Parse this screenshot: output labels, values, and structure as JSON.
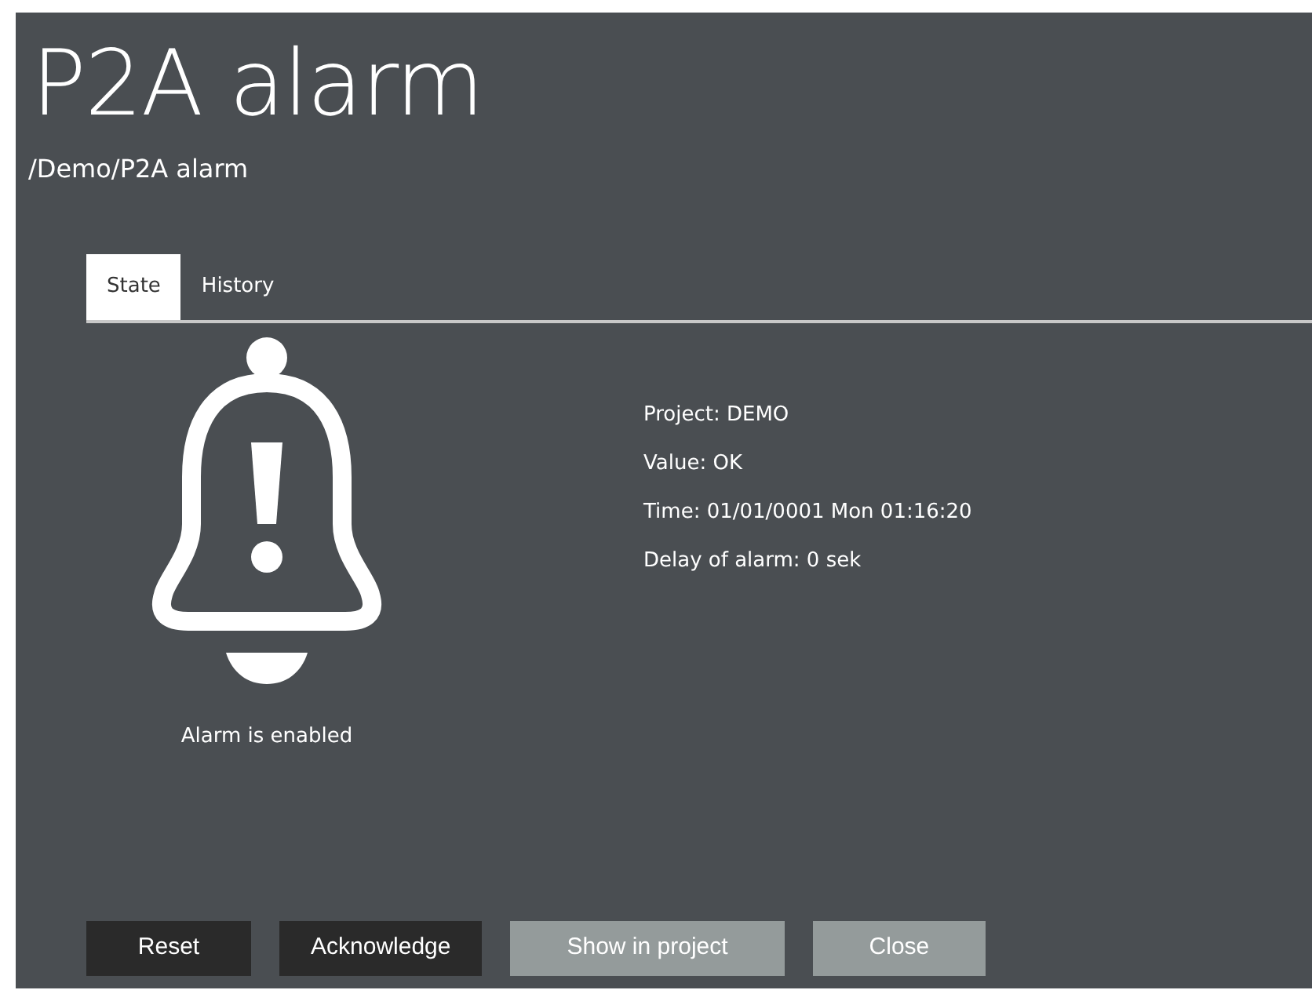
{
  "title": "P2A alarm",
  "path": "/Demo/P2A alarm",
  "tabs": [
    {
      "label": "State",
      "selected": true
    },
    {
      "label": "History",
      "selected": false
    }
  ],
  "status": {
    "text": "Alarm is enabled",
    "enabled": true
  },
  "details": [
    "Project: DEMO",
    "Value: OK",
    "Time: 01/01/0001 Mon 01:16:20",
    "Delay of alarm: 0 sek"
  ],
  "buttons": [
    {
      "label": "Reset",
      "kind": "dark"
    },
    {
      "label": "Acknowledge",
      "kind": "dark"
    },
    {
      "label": "Show in project",
      "kind": "light"
    },
    {
      "label": "Close",
      "kind": "light"
    }
  ]
}
